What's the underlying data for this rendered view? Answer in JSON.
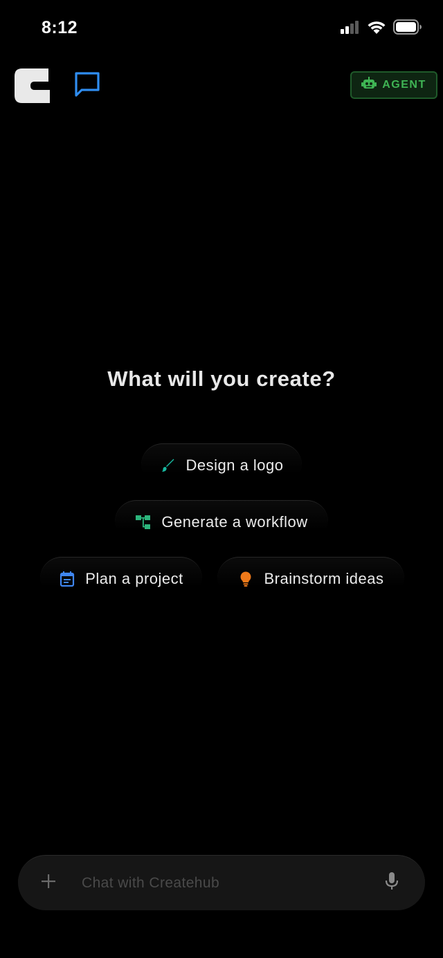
{
  "status_bar": {
    "time": "8:12",
    "icons": [
      "cellular-signal-icon",
      "wifi-icon",
      "battery-icon"
    ]
  },
  "header": {
    "logo": "createhub-logo",
    "chat_icon": "chat-bubble-icon",
    "agent_button": {
      "label": "AGENT",
      "icon": "robot-icon"
    }
  },
  "main": {
    "headline": "What will you create?",
    "suggestions": [
      {
        "label": "Design a logo",
        "icon": "brush-icon"
      },
      {
        "label": "Generate a workflow",
        "icon": "workflow-icon"
      },
      {
        "label": "Plan a project",
        "icon": "calendar-icon"
      },
      {
        "label": "Brainstorm ideas",
        "icon": "lightbulb-icon"
      }
    ]
  },
  "composer": {
    "placeholder": "Chat with Createhub",
    "value": "",
    "plus_icon": "plus-icon",
    "mic_icon": "microphone-icon"
  },
  "colors": {
    "background": "#000000",
    "chat_icon": "#2f8df0",
    "agent_green": "#3fb454",
    "agent_bg": "#0e2512",
    "brush": "#18b8a0",
    "workflow": "#2cb57c",
    "calendar": "#3f86f0",
    "lightbulb": "#f07a1a"
  }
}
